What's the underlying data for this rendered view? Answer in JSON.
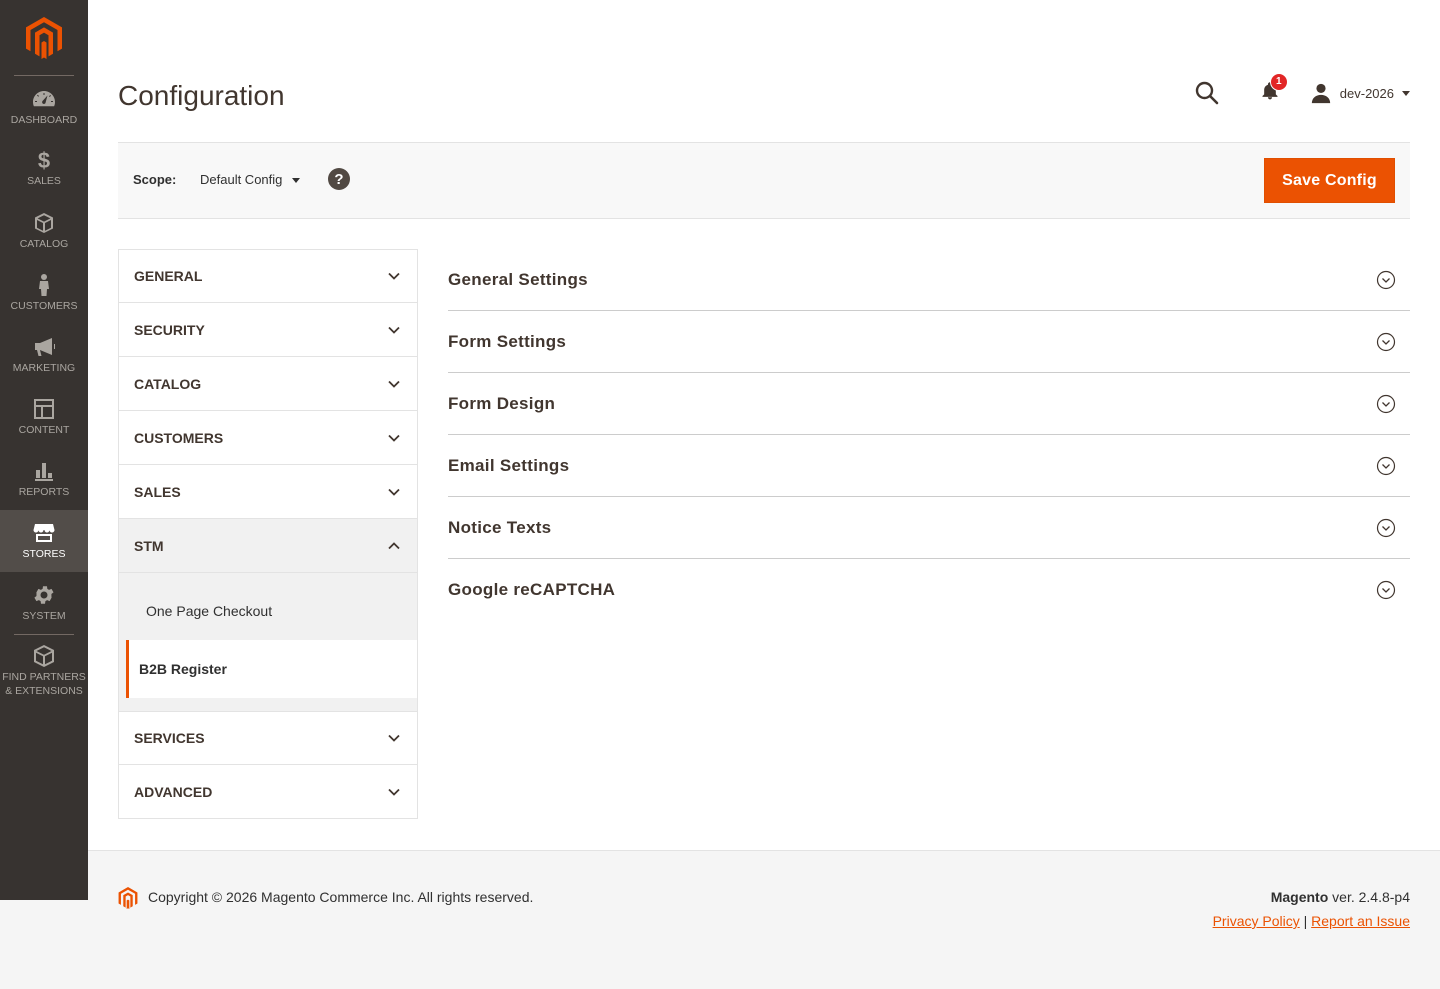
{
  "sidebar": {
    "items": [
      {
        "label": "Dashboard",
        "icon": "dashboard-icon"
      },
      {
        "label": "$",
        "label2": "Sales",
        "icon": "dollar-icon"
      },
      {
        "label": "Catalog",
        "icon": "box-icon"
      },
      {
        "label": "Customers",
        "icon": "person-icon"
      },
      {
        "label": "Marketing",
        "icon": "megaphone-icon"
      },
      {
        "label": "Content",
        "icon": "layout-icon"
      },
      {
        "label": "Reports",
        "icon": "bar-chart-icon"
      },
      {
        "label": "Stores",
        "icon": "store-icon",
        "active": true
      },
      {
        "label": "System",
        "icon": "gear-icon"
      },
      {
        "label": "Find Partners",
        "label_line2": "& Extensions",
        "icon": "cube-icon"
      }
    ]
  },
  "header": {
    "title": "Configuration",
    "notifications_count": "1",
    "user_name": "dev-2026"
  },
  "scope": {
    "label": "Scope:",
    "value": "Default Config",
    "help": "?",
    "save_label": "Save Config"
  },
  "tabs": [
    {
      "label": "GENERAL"
    },
    {
      "label": "SECURITY"
    },
    {
      "label": "CATALOG"
    },
    {
      "label": "CUSTOMERS"
    },
    {
      "label": "SALES"
    },
    {
      "label": "STM",
      "open": true
    },
    {
      "label": "SERVICES"
    },
    {
      "label": "ADVANCED"
    }
  ],
  "stm_items": [
    {
      "label": "One Page Checkout"
    },
    {
      "label": "B2B Register",
      "active": true
    }
  ],
  "sections": [
    {
      "title": "General Settings"
    },
    {
      "title": "Form Settings"
    },
    {
      "title": "Form Design"
    },
    {
      "title": "Email Settings"
    },
    {
      "title": "Notice Texts"
    },
    {
      "title": "Google reCAPTCHA"
    }
  ],
  "footer": {
    "copyright": "Copyright © 2026 Magento Commerce Inc. All rights reserved.",
    "brand": "Magento",
    "version": " ver. 2.4.8-p4",
    "privacy": "Privacy Policy",
    "separator": "|",
    "report": "Report an Issue"
  },
  "colors": {
    "accent": "#eb5202",
    "sidebar": "#373330",
    "sidebar_active": "#524d49"
  }
}
